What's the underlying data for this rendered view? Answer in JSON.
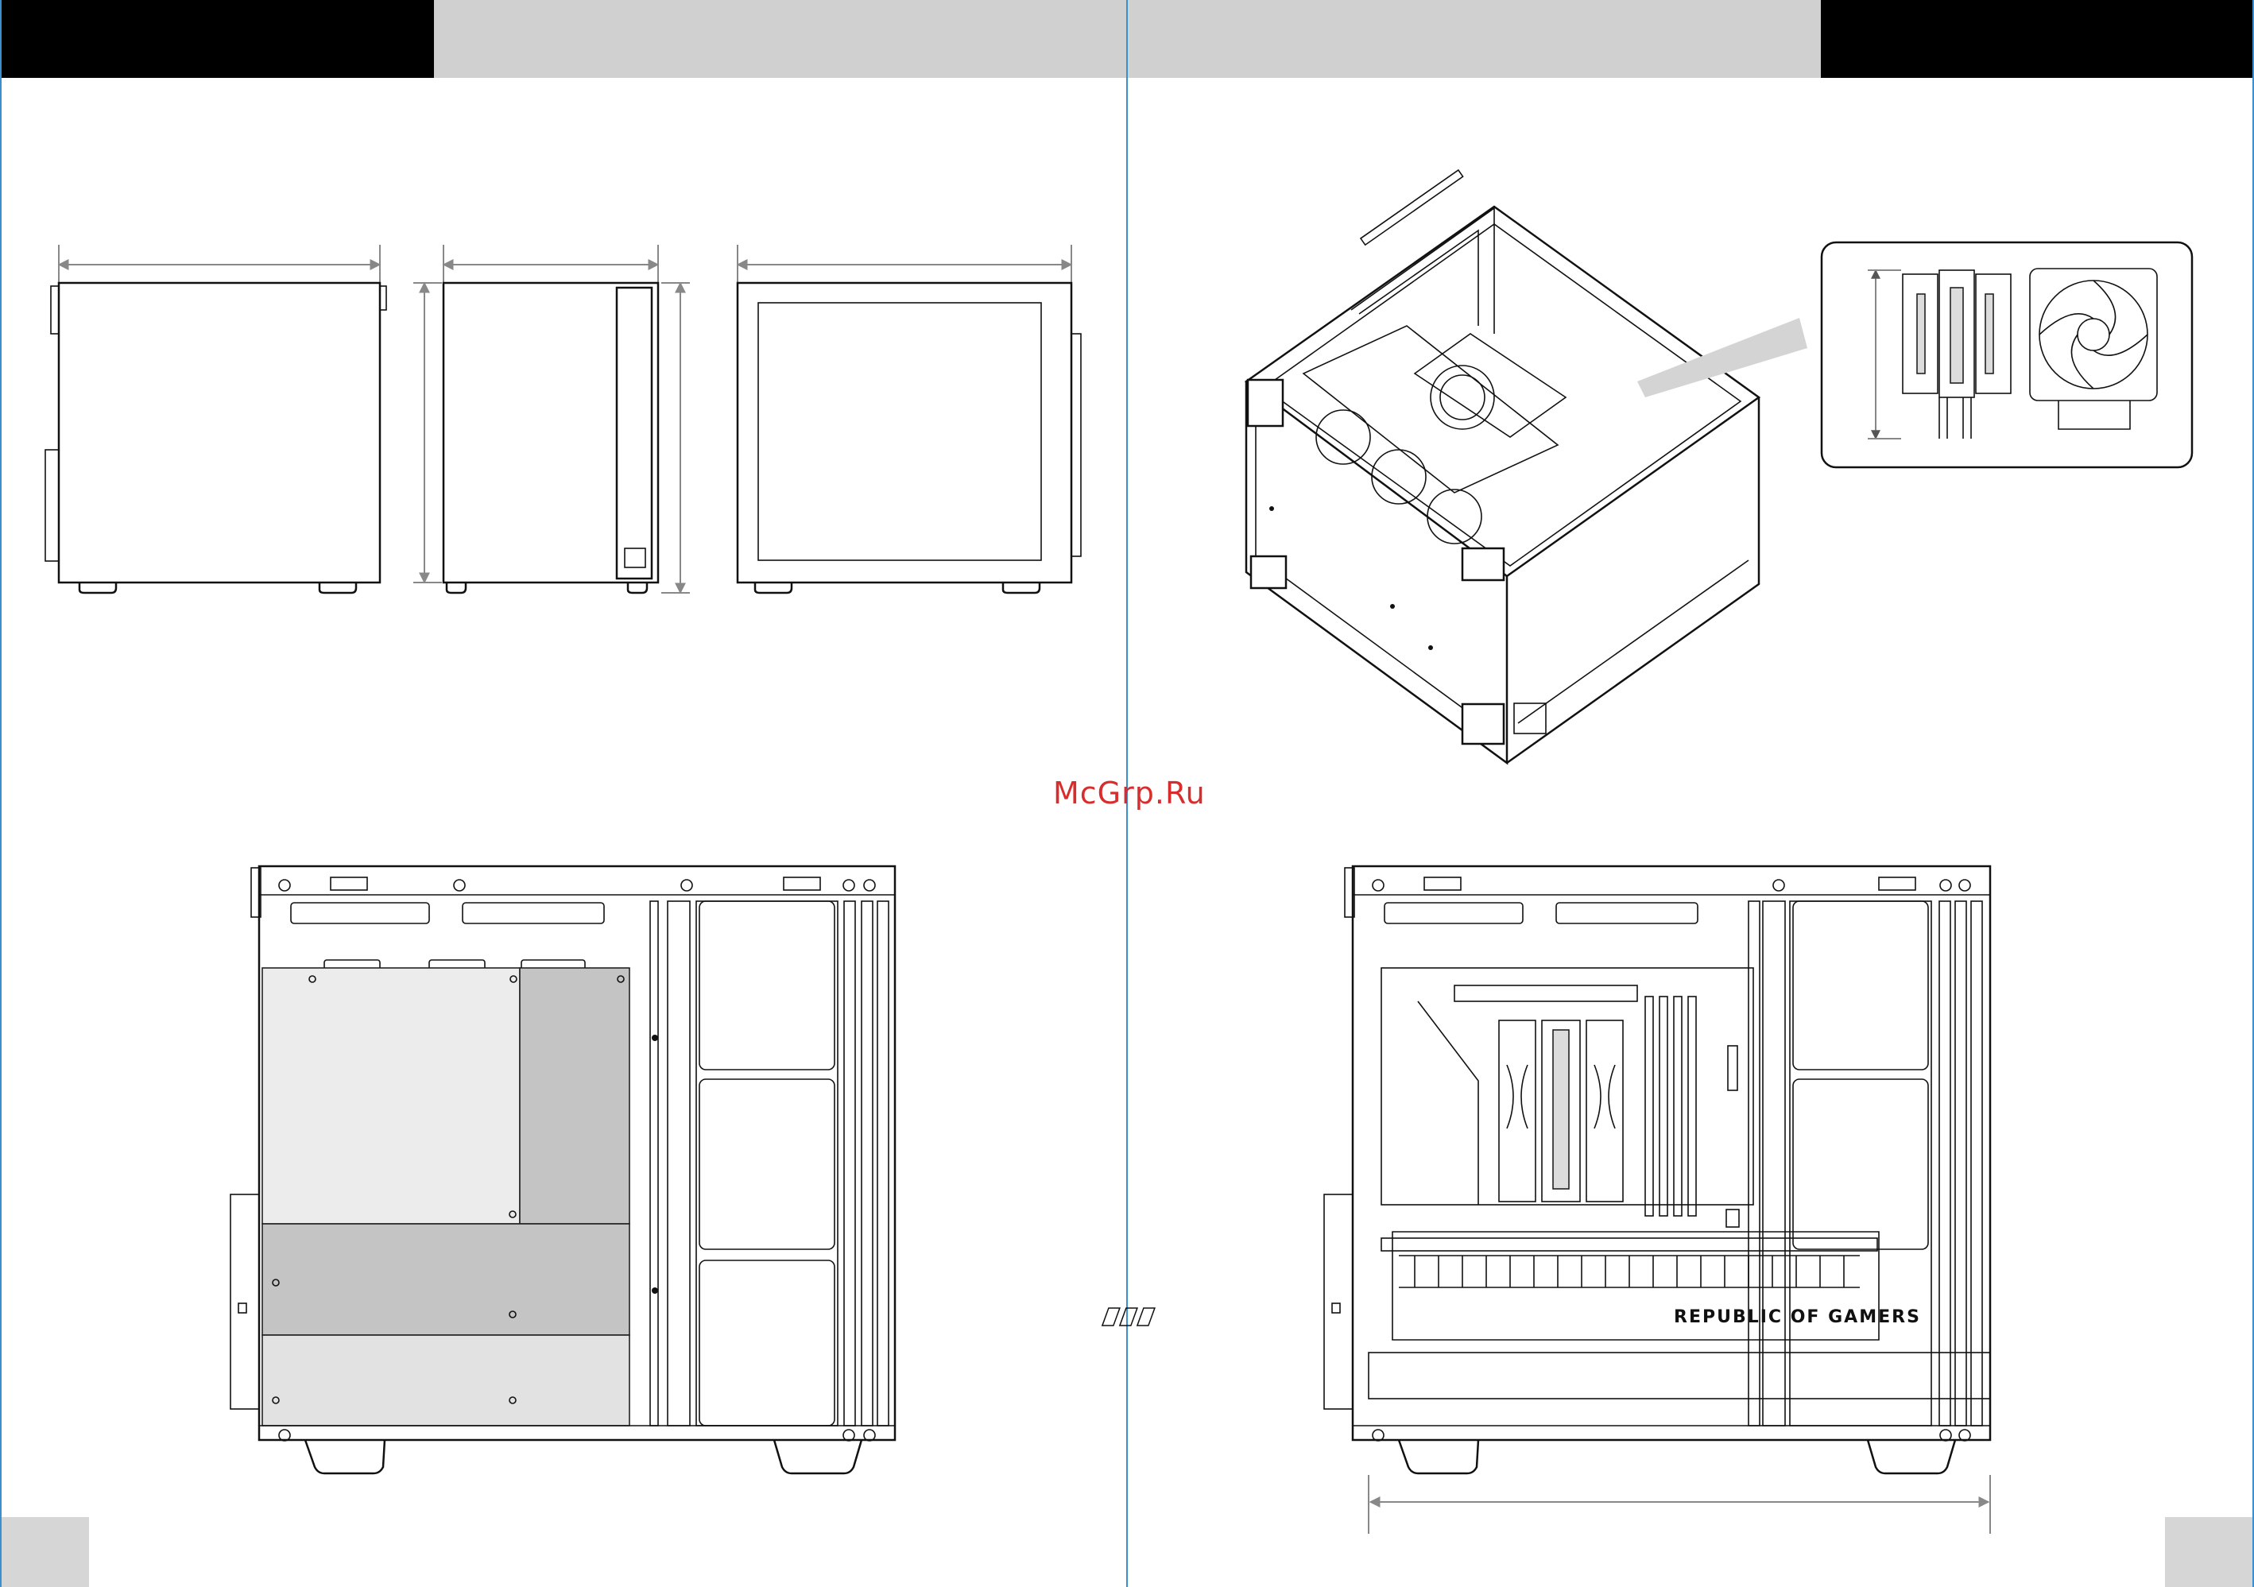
{
  "document": {
    "watermark": "McGrp.Ru",
    "gpu_brand_text": "REPUBLIC OF GAMERS",
    "colors": {
      "header_black": "#000000",
      "header_gray": "#d0d0d0",
      "page_border": "#3a8fd0",
      "watermark": "#d82d2d",
      "psu_light": "#ececec",
      "psu_mid": "#c4c4c4",
      "psu_low": "#e2e2e2"
    }
  }
}
